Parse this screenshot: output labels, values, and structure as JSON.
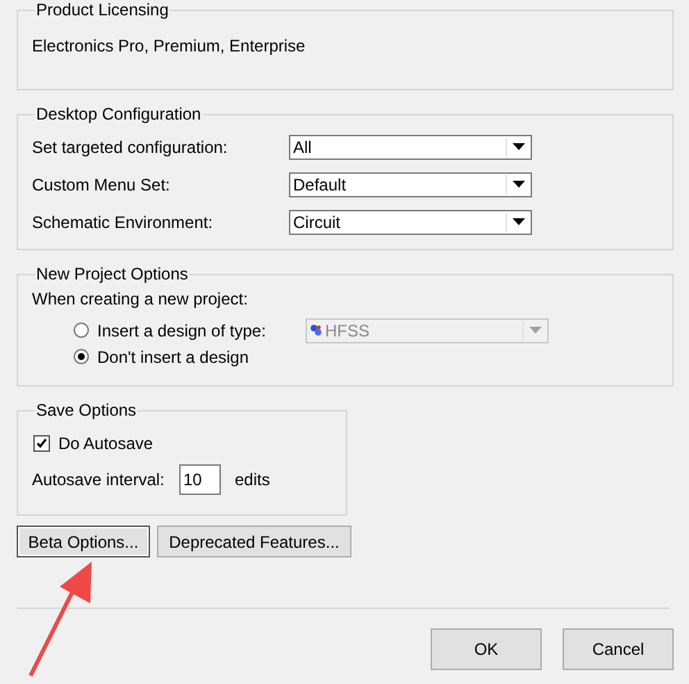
{
  "product_licensing": {
    "title": "Product Licensing",
    "text": "Electronics Pro, Premium, Enterprise"
  },
  "desktop_configuration": {
    "title": "Desktop Configuration",
    "rows": [
      {
        "label": "Set targeted configuration:",
        "value": "All"
      },
      {
        "label": "Custom Menu Set:",
        "value": "Default"
      },
      {
        "label": "Schematic Environment:",
        "value": "Circuit"
      }
    ]
  },
  "new_project_options": {
    "title": "New Project Options",
    "prompt": "When creating a new project:",
    "options": [
      {
        "label": "Insert a design of type:",
        "selected": false
      },
      {
        "label": "Don't insert a design",
        "selected": true
      }
    ],
    "design_type": {
      "value": "HFSS",
      "disabled": true
    }
  },
  "save_options": {
    "title": "Save Options",
    "autosave": {
      "label": "Do Autosave",
      "checked": true
    },
    "interval": {
      "label": "Autosave interval:",
      "value": "10",
      "unit": "edits"
    }
  },
  "buttons": [
    {
      "label": "Beta Options...",
      "focused": true
    },
    {
      "label": "Deprecated Features...",
      "focused": false
    }
  ],
  "dialog_buttons": [
    "OK",
    "Cancel"
  ]
}
